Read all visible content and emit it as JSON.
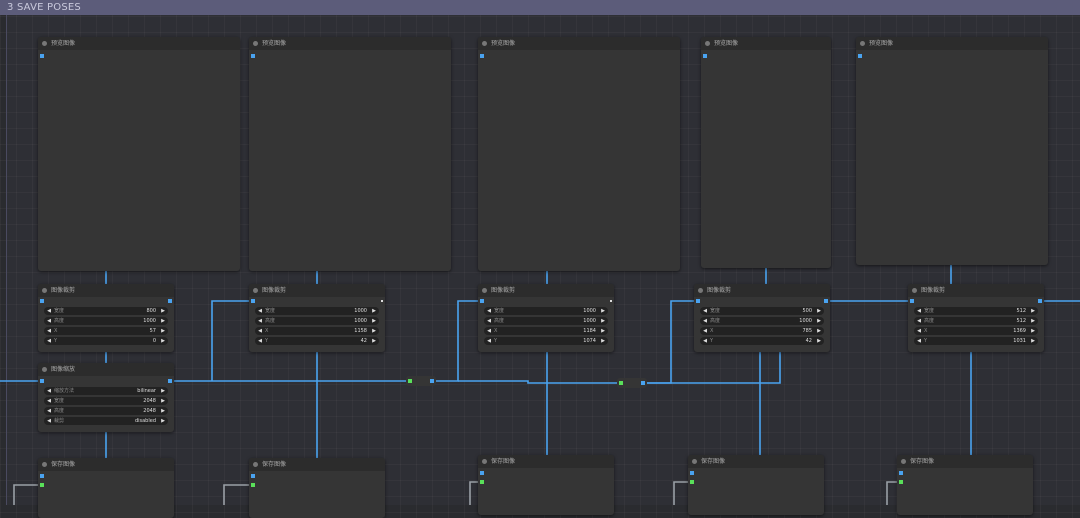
{
  "group": {
    "title": "3 SAVE POSES"
  },
  "preview_nodes": [
    {
      "title": "预览图像"
    },
    {
      "title": "预览图像"
    },
    {
      "title": "预览图像"
    },
    {
      "title": "预览图像"
    },
    {
      "title": "预览图像"
    }
  ],
  "crop_nodes": [
    {
      "title": "图像裁剪",
      "fields": [
        {
          "label": "宽度",
          "value": "800"
        },
        {
          "label": "高度",
          "value": "1000"
        },
        {
          "label": "X",
          "value": "57"
        },
        {
          "label": "Y",
          "value": "0"
        }
      ]
    },
    {
      "title": "图像裁剪",
      "fields": [
        {
          "label": "宽度",
          "value": "1000"
        },
        {
          "label": "高度",
          "value": "1000"
        },
        {
          "label": "X",
          "value": "1158"
        },
        {
          "label": "Y",
          "value": "42"
        }
      ]
    },
    {
      "title": "图像裁剪",
      "fields": [
        {
          "label": "宽度",
          "value": "1000"
        },
        {
          "label": "高度",
          "value": "1000"
        },
        {
          "label": "X",
          "value": "1184"
        },
        {
          "label": "Y",
          "value": "1074"
        }
      ]
    },
    {
      "title": "图像裁剪",
      "fields": [
        {
          "label": "宽度",
          "value": "500"
        },
        {
          "label": "高度",
          "value": "1000"
        },
        {
          "label": "X",
          "value": "785"
        },
        {
          "label": "Y",
          "value": "42"
        }
      ]
    },
    {
      "title": "图像裁剪",
      "fields": [
        {
          "label": "宽度",
          "value": "512"
        },
        {
          "label": "高度",
          "value": "512"
        },
        {
          "label": "X",
          "value": "1369"
        },
        {
          "label": "Y",
          "value": "1031"
        }
      ]
    }
  ],
  "scale_node": {
    "title": "图像缩放",
    "fields": [
      {
        "label": "缩放方法",
        "value": "bilinear"
      },
      {
        "label": "宽度",
        "value": "2048"
      },
      {
        "label": "高度",
        "value": "2048"
      },
      {
        "label": "裁剪",
        "value": "disabled"
      }
    ]
  },
  "save_nodes": [
    {
      "title": "保存图像"
    },
    {
      "title": "保存图像"
    },
    {
      "title": "保存图像"
    },
    {
      "title": "保存图像"
    },
    {
      "title": "保存图像"
    }
  ],
  "colors": {
    "link": "#4aa3f0",
    "image_port": "#4aa3f0",
    "mask_port": "#5ae05a",
    "group_header": "#5c5c7a"
  }
}
